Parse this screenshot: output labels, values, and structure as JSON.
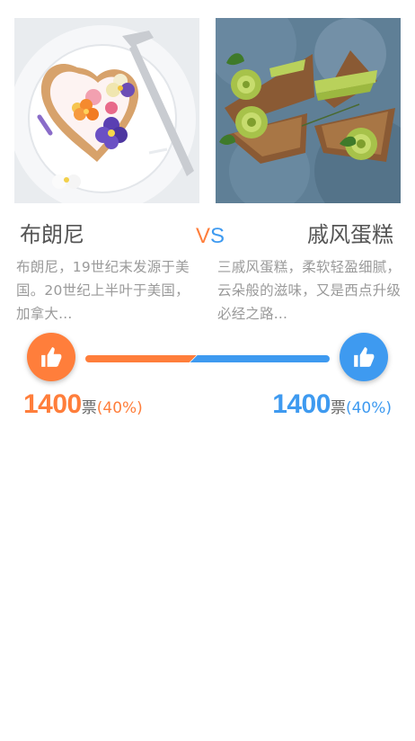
{
  "left": {
    "title": "布朗尼",
    "description": "布朗尼，19世纪末发源于美国。20世纪上半叶于美国，加拿大...",
    "image": "brownie-with-edible-flowers-photo",
    "votes": "1400",
    "vote_unit": "票",
    "percent_label": "(40%)",
    "color": "#ff7e3b"
  },
  "vs": {
    "v": "V",
    "s": "S"
  },
  "right": {
    "title": "戚风蛋糕",
    "description": "三戚风蛋糕，柔软轻盈细腻，云朵般的滋味，又是西点升级必经之路...",
    "image": "avocado-rose-toast-photo",
    "votes": "1400",
    "vote_unit": "票",
    "percent_label": "(40%)",
    "color": "#3e9af0"
  },
  "vote_bar": {
    "left_share": 0.44,
    "left_color": "#ff7e3b",
    "right_color": "#3e9af0"
  },
  "icons": {
    "left_button": "thumbs-up-icon",
    "right_button": "thumbs-up-icon"
  }
}
